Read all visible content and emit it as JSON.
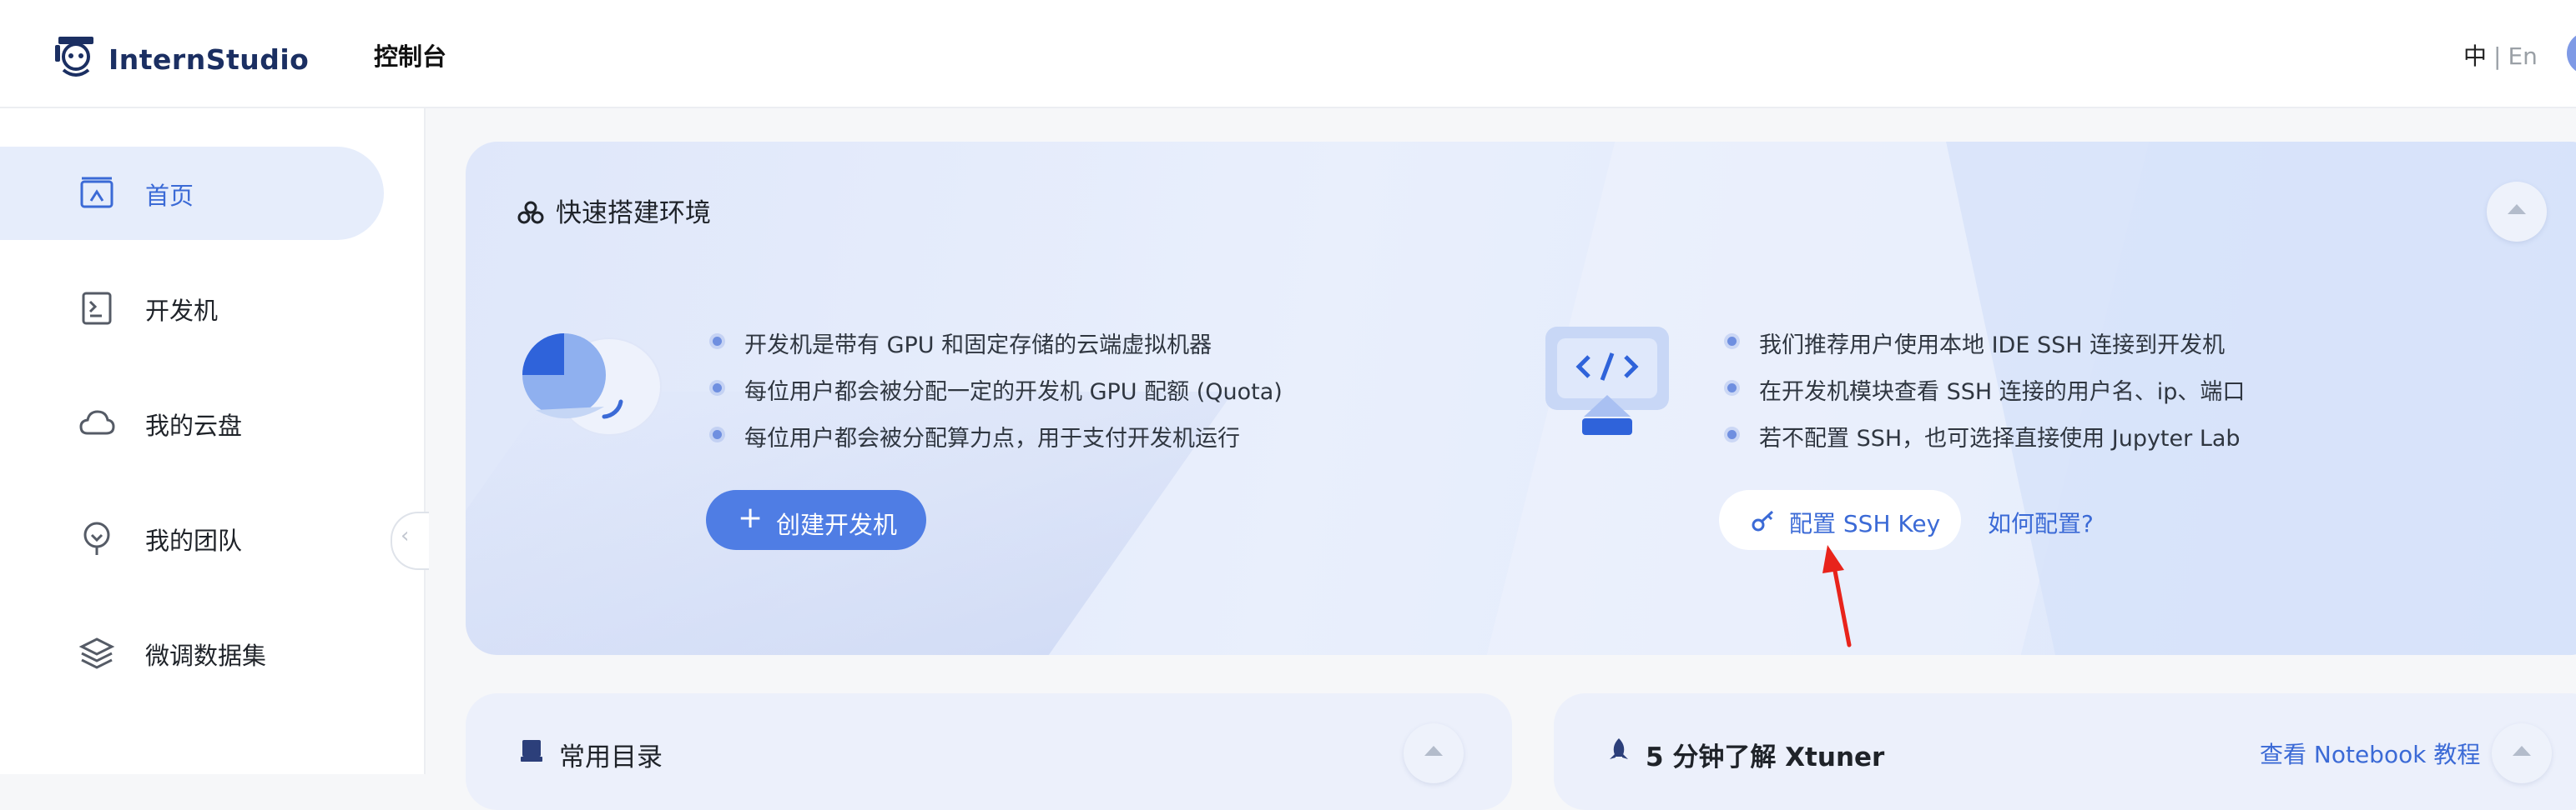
{
  "header": {
    "brand": "InternStudio",
    "console": "控制台",
    "lang_zh": "中",
    "lang_sep": "|",
    "lang_en": "En"
  },
  "sidebar": {
    "items": [
      {
        "label": "首页",
        "icon": "home-icon",
        "active": true
      },
      {
        "label": "开发机",
        "icon": "terminal-icon",
        "active": false
      },
      {
        "label": "我的云盘",
        "icon": "cloud-icon",
        "active": false
      },
      {
        "label": "我的团队",
        "icon": "team-icon",
        "active": false
      },
      {
        "label": "微调数据集",
        "icon": "dataset-icon",
        "active": false
      }
    ]
  },
  "quick_setup": {
    "title": "快速搭建环境",
    "left_points": [
      "开发机是带有 GPU 和固定存储的云端虚拟机器",
      "每位用户都会被分配一定的开发机 GPU 配额 (Quota)",
      "每位用户都会被分配算力点，用于支付开发机运行"
    ],
    "create_button": "创建开发机",
    "right_points": [
      "我们推荐用户使用本地 IDE SSH 连接到开发机",
      "在开发机模块查看 SSH 连接的用户名、ip、端口",
      "若不配置 SSH，也可选择直接使用 Jupyter Lab"
    ],
    "ssh_button": "配置 SSH Key",
    "how_link": "如何配置?"
  },
  "common_dirs": {
    "title": "常用目录"
  },
  "xtuner": {
    "title": "5 分钟了解 Xtuner",
    "link": "查看 Notebook 教程"
  },
  "colors": {
    "accent": "#4f7de4",
    "link": "#3b6ad6",
    "arrow": "#e8231b"
  }
}
